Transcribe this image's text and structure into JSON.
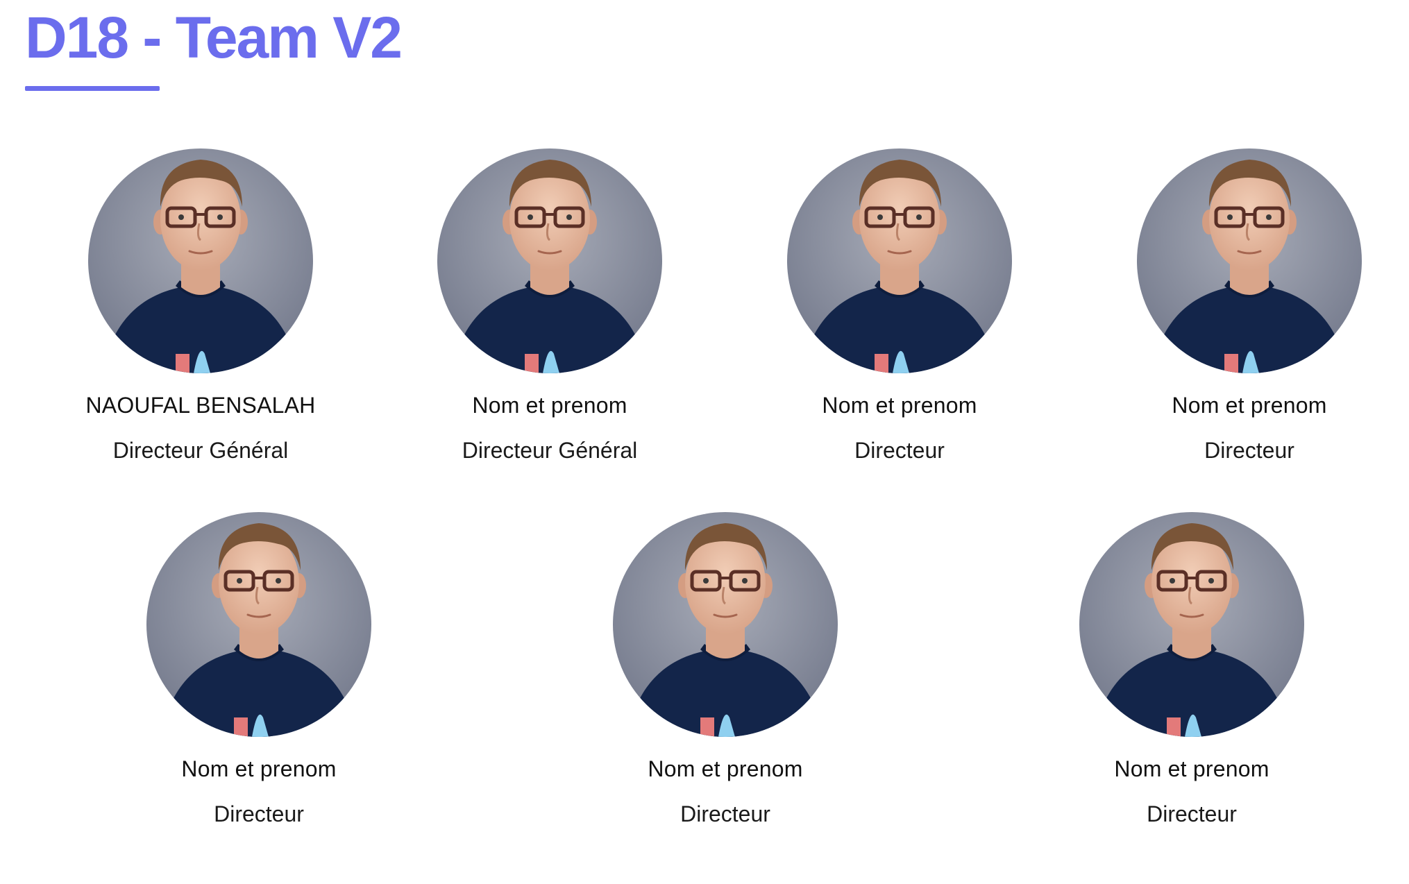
{
  "page": {
    "title": "D18 - Team V2",
    "accent_color": "#6b6ded"
  },
  "team": {
    "members": [
      {
        "name": "NAOUFAL BENSALAH",
        "role": "Directeur Général",
        "photo": "portrait-photo"
      },
      {
        "name": "Nom et prenom",
        "role": "Directeur Général",
        "photo": "portrait-photo"
      },
      {
        "name": "Nom et prenom",
        "role": "Directeur",
        "photo": "portrait-photo"
      },
      {
        "name": "Nom et prenom",
        "role": "Directeur",
        "photo": "portrait-photo"
      },
      {
        "name": "Nom et prenom",
        "role": "Directeur",
        "photo": "portrait-photo"
      },
      {
        "name": "Nom et prenom",
        "role": "Directeur",
        "photo": "portrait-photo"
      },
      {
        "name": "Nom et prenom",
        "role": "Directeur",
        "photo": "portrait-photo"
      }
    ]
  }
}
